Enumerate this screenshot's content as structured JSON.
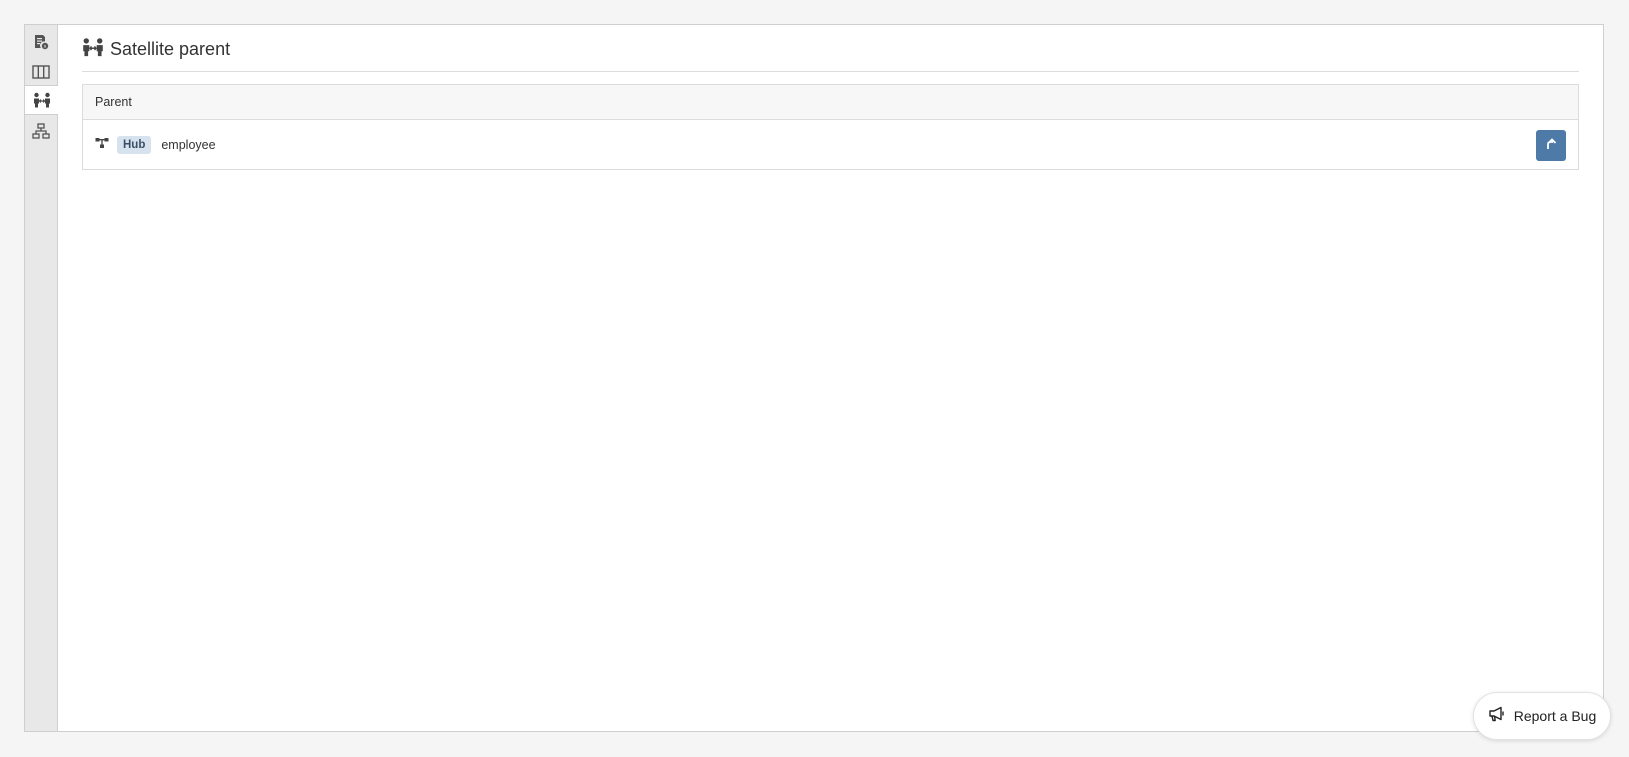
{
  "sidebar": {
    "items": [
      {
        "icon": "document-info-icon",
        "active": false
      },
      {
        "icon": "columns-icon",
        "active": false
      },
      {
        "icon": "satellite-parent-icon",
        "active": true
      },
      {
        "icon": "sitemap-icon",
        "active": false
      }
    ]
  },
  "header": {
    "icon": "satellite-parent-icon",
    "title": "Satellite parent"
  },
  "table": {
    "column_header": "Parent",
    "rows": [
      {
        "icon": "hub-icon",
        "badge": "Hub",
        "name": "employee",
        "action_icon": "navigate-up-icon"
      }
    ]
  },
  "report_bug": {
    "icon": "megaphone-icon",
    "label": "Report a Bug"
  },
  "colors": {
    "accent": "#4d7aa6",
    "badge_bg": "#d6e2ee",
    "sidebar_bg": "#e8e8e8"
  }
}
